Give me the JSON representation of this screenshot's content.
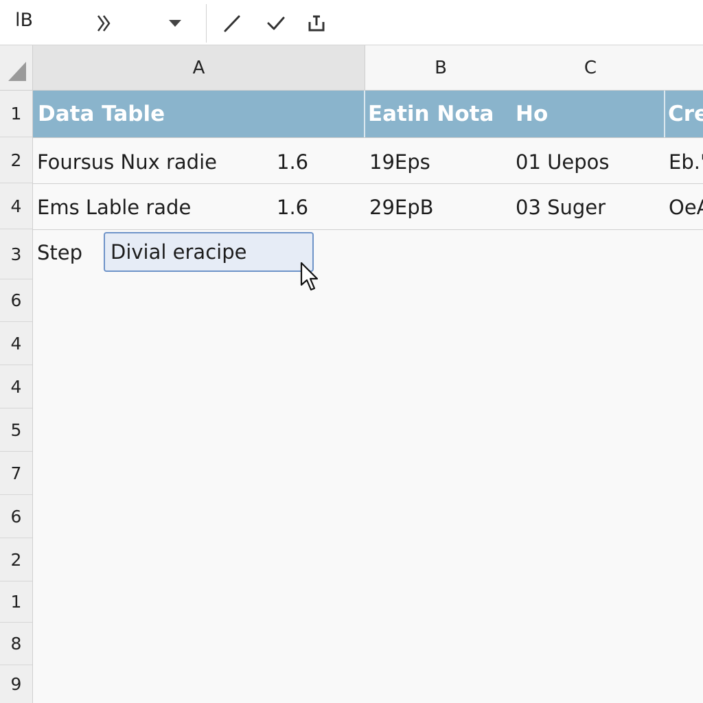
{
  "toolbar": {
    "name_box": "lB",
    "icons": [
      "transform-icon",
      "dropdown-icon",
      "pencil-icon",
      "check-icon",
      "save-icon"
    ]
  },
  "columns": [
    "A",
    "B",
    "C"
  ],
  "row_numbers": [
    "1",
    "2",
    "4",
    "3",
    "6",
    "4",
    "4",
    "5",
    "7",
    "6",
    "2",
    "1",
    "8",
    "9"
  ],
  "table": {
    "header": {
      "a": "Data Table",
      "b": "Eatin Nota",
      "c": "Ho",
      "d": "Cre"
    },
    "rows": [
      {
        "a": "Foursus Nux radie",
        "a2": "1.6",
        "b": "19Eps",
        "c": "01 Uepos",
        "d": "Eb.'"
      },
      {
        "a": "Ems Lable rade",
        "a2": "1.6",
        "b": "29EpB",
        "c": "03 Suger",
        "d": "OeA"
      }
    ]
  },
  "step_row": {
    "label": "Step",
    "editing_value": "Divial eracipe"
  },
  "colors": {
    "header_band": "#8ab4cc",
    "edit_border": "#6e93c8",
    "edit_fill": "#e6ecf6"
  }
}
